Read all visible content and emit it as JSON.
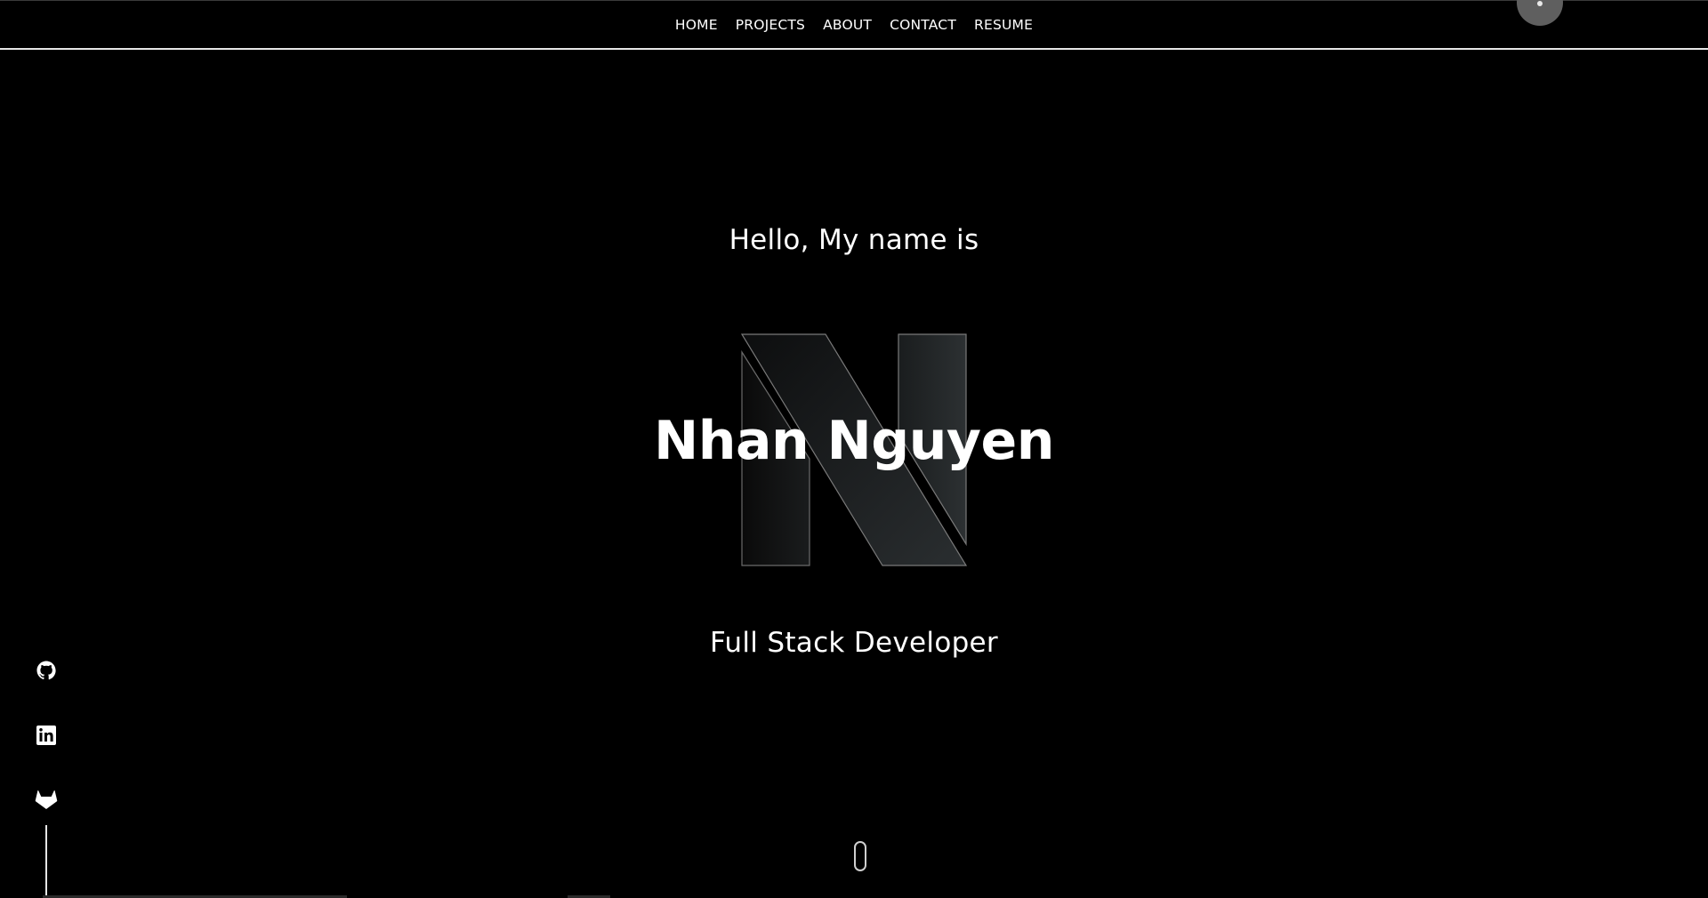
{
  "nav": {
    "items": [
      {
        "label": "HOME"
      },
      {
        "label": "PROJECTS"
      },
      {
        "label": "ABOUT"
      },
      {
        "label": "CONTACT"
      },
      {
        "label": "RESUME"
      }
    ]
  },
  "hero": {
    "greeting": "Hello, My name is",
    "name": "Nhan Nguyen",
    "role": "Full Stack Developer",
    "logo_letter": "N"
  },
  "social": {
    "items": [
      {
        "icon": "github-icon"
      },
      {
        "icon": "linkedin-icon"
      },
      {
        "icon": "gitlab-icon"
      }
    ]
  },
  "colors": {
    "background": "#000000",
    "text": "#ffffff",
    "accent_gray": "#5f5f5f"
  }
}
